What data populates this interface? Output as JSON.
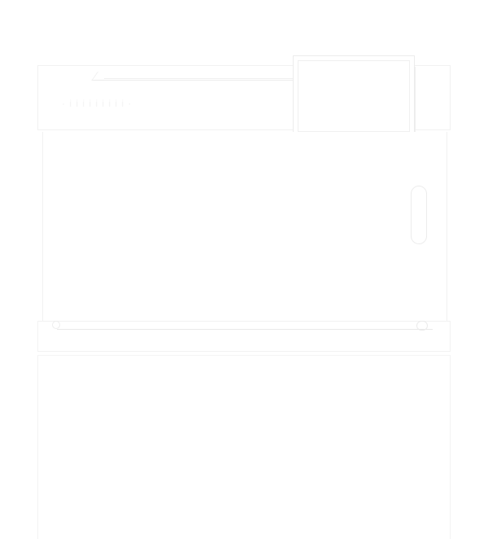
{
  "panel": {
    "label": "· i i i i i i i i i ·"
  },
  "colors": {
    "background": "#ffffff",
    "outline": "#f1f1f1"
  }
}
